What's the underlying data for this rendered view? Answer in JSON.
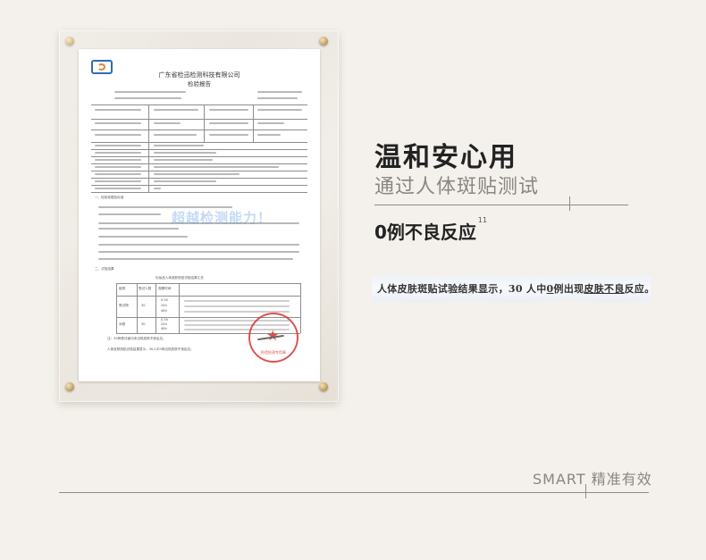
{
  "report": {
    "company_name": "广东省检迅检测科技有限公司",
    "title": "检验报告",
    "watermark": "超越检测能力！",
    "intro_heading": "一、检验依据及标准",
    "test_heading": "二、试验结果",
    "table_title": "化妆品人体皮肤斑贴试验结果汇总",
    "table_headers": [
      "组别",
      "受试人数",
      "观察时间"
    ],
    "row_labels": [
      "受试物",
      "对照"
    ],
    "counts": [
      "30",
      "30"
    ],
    "times": [
      "0.5h",
      "24h",
      "48h"
    ],
    "footer_note": "注：30例受试者均未出现皮肤不良反应。",
    "conclusion": "人体皮肤斑贴试验结果显示，30人中0例出现皮肤不良反应。",
    "stamp_text": "检验检测专用章"
  },
  "headline": "温和安心用",
  "subheadline": "通过人体斑贴测试",
  "claim": {
    "text": "0例不良反应",
    "superscript": "11"
  },
  "clipping": {
    "part1": "人体皮肤斑贴试验结果显示，30 人中",
    "highlight1": "0",
    "part2": "例出现",
    "highlight2": "皮肤不良",
    "part3": "反应。"
  },
  "footer": {
    "tagline": "SMART 精准有效"
  }
}
